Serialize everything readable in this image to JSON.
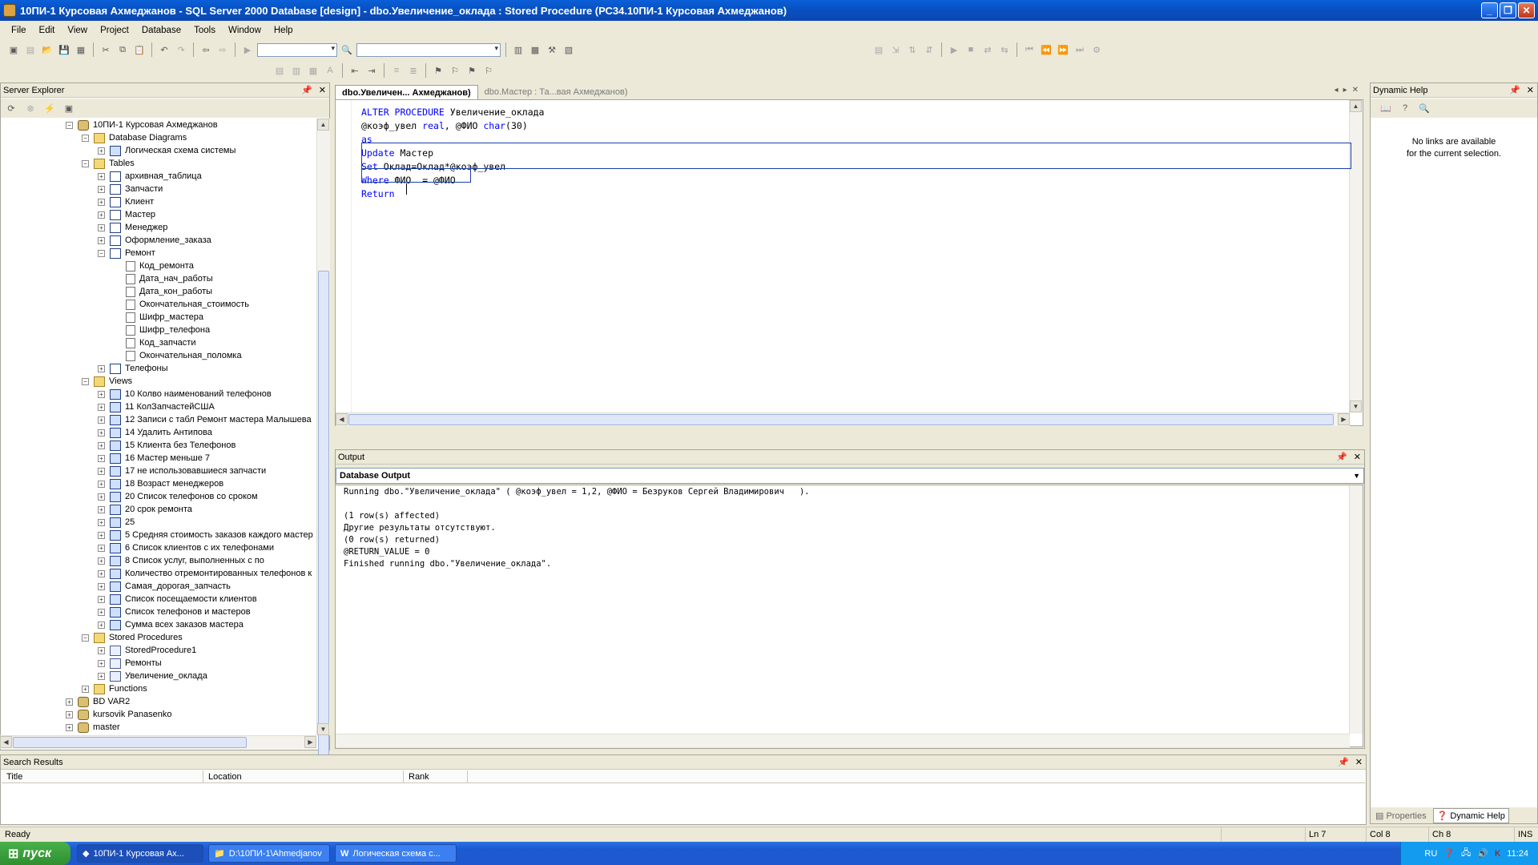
{
  "window": {
    "title": "10ПИ-1 Курсовая Ахмеджанов - SQL Server 2000 Database [design] - dbo.Увеличение_оклада : Stored Procedure (РС34.10ПИ-1 Курсовая Ахмеджанов)"
  },
  "menu": [
    "File",
    "Edit",
    "View",
    "Project",
    "Database",
    "Tools",
    "Window",
    "Help"
  ],
  "server_explorer": {
    "title": "Server Explorer",
    "items": [
      {
        "label": "10ПИ-1 Курсовая Ахмеджанов",
        "icon": "database-icon",
        "level": 0,
        "expanded": true
      },
      {
        "label": "Database Diagrams",
        "icon": "folder-icon",
        "level": 1,
        "expanded": true
      },
      {
        "label": "Логическая схема системы",
        "icon": "diagram-icon",
        "level": 2,
        "expanded": false
      },
      {
        "label": "Tables",
        "icon": "folder-icon",
        "level": 1,
        "expanded": true
      },
      {
        "label": "архивная_таблица",
        "icon": "table-icon",
        "level": 2,
        "expanded": false
      },
      {
        "label": "Запчасти",
        "icon": "table-icon",
        "level": 2,
        "expanded": false
      },
      {
        "label": "Клиент",
        "icon": "table-icon",
        "level": 2,
        "expanded": false
      },
      {
        "label": "Мастер",
        "icon": "table-icon",
        "level": 2,
        "expanded": false
      },
      {
        "label": "Менеджер",
        "icon": "table-icon",
        "level": 2,
        "expanded": false
      },
      {
        "label": "Оформление_заказа",
        "icon": "table-icon",
        "level": 2,
        "expanded": false
      },
      {
        "label": "Ремонт",
        "icon": "table-icon",
        "level": 2,
        "expanded": true
      },
      {
        "label": "Код_ремонта",
        "icon": "column-icon",
        "level": 3
      },
      {
        "label": "Дата_нач_работы",
        "icon": "column-icon",
        "level": 3
      },
      {
        "label": "Дата_кон_работы",
        "icon": "column-icon",
        "level": 3
      },
      {
        "label": "Окончательная_стоимость",
        "icon": "column-icon",
        "level": 3
      },
      {
        "label": "Шифр_мастера",
        "icon": "column-icon",
        "level": 3
      },
      {
        "label": "Шифр_телефона",
        "icon": "column-icon",
        "level": 3
      },
      {
        "label": "Код_запчасти",
        "icon": "column-icon",
        "level": 3
      },
      {
        "label": "Окончательная_поломка",
        "icon": "column-icon",
        "level": 3
      },
      {
        "label": "Телефоны",
        "icon": "table-icon",
        "level": 2,
        "expanded": false
      },
      {
        "label": "Views",
        "icon": "folder-icon",
        "level": 1,
        "expanded": true
      },
      {
        "label": "10 Колво наименований телефонов",
        "icon": "view-icon",
        "level": 2,
        "expanded": false
      },
      {
        "label": "11 КолЗапчастейСША",
        "icon": "view-icon",
        "level": 2,
        "expanded": false
      },
      {
        "label": "12 Записи с табл Ремонт мастера Малышева",
        "icon": "view-icon",
        "level": 2,
        "expanded": false
      },
      {
        "label": "14 Удалить Антипова",
        "icon": "view-icon",
        "level": 2,
        "expanded": false
      },
      {
        "label": "15 Клиента без Телефонов",
        "icon": "view-icon",
        "level": 2,
        "expanded": false
      },
      {
        "label": "16 Мастер меньше 7",
        "icon": "view-icon",
        "level": 2,
        "expanded": false
      },
      {
        "label": "17 не использовавшиеся запчасти",
        "icon": "view-icon",
        "level": 2,
        "expanded": false
      },
      {
        "label": "18 Возраст менеджеров",
        "icon": "view-icon",
        "level": 2,
        "expanded": false
      },
      {
        "label": "20 Список телефонов со сроком",
        "icon": "view-icon",
        "level": 2,
        "expanded": false
      },
      {
        "label": "20 срок ремонта",
        "icon": "view-icon",
        "level": 2,
        "expanded": false
      },
      {
        "label": "25",
        "icon": "view-icon",
        "level": 2,
        "expanded": false
      },
      {
        "label": "5 Средняя стоимость заказов каждого мастер",
        "icon": "view-icon",
        "level": 2,
        "expanded": false
      },
      {
        "label": "6 Список клиентов с их телефонами",
        "icon": "view-icon",
        "level": 2,
        "expanded": false
      },
      {
        "label": "8 Список услуг, выполненных с по",
        "icon": "view-icon",
        "level": 2,
        "expanded": false
      },
      {
        "label": "Количество отремонтированных телефонов к",
        "icon": "view-icon",
        "level": 2,
        "expanded": false
      },
      {
        "label": "Самая_дорогая_запчасть",
        "icon": "view-icon",
        "level": 2,
        "expanded": false
      },
      {
        "label": "Список посещаемости клиентов",
        "icon": "view-icon",
        "level": 2,
        "expanded": false
      },
      {
        "label": "Список телефонов и мастеров",
        "icon": "view-icon",
        "level": 2,
        "expanded": false
      },
      {
        "label": "Сумма всех заказов мастера",
        "icon": "view-icon",
        "level": 2,
        "expanded": false
      },
      {
        "label": "Stored Procedures",
        "icon": "folder-icon",
        "level": 1,
        "expanded": true
      },
      {
        "label": "StoredProcedure1",
        "icon": "stored-procedure-icon",
        "level": 2,
        "expanded": false
      },
      {
        "label": "Ремонты",
        "icon": "stored-procedure-icon",
        "level": 2,
        "expanded": false
      },
      {
        "label": "Увеличение_оклада",
        "icon": "stored-procedure-icon",
        "level": 2,
        "expanded": false
      },
      {
        "label": "Functions",
        "icon": "folder-icon",
        "level": 1,
        "expanded": false
      },
      {
        "label": "BD VAR2",
        "icon": "database-icon",
        "level": 0,
        "expanded": false
      },
      {
        "label": "kursovik Panasenko",
        "icon": "database-icon",
        "level": 0,
        "expanded": false
      },
      {
        "label": "master",
        "icon": "database-icon",
        "level": 0,
        "expanded": false
      }
    ]
  },
  "editor": {
    "tabs": [
      {
        "label": "dbo.Увеличен... Ахмеджанов)",
        "active": true
      },
      {
        "label": "dbo.Мастер : Та...вая Ахмеджанов)",
        "active": false
      }
    ],
    "lines": [
      [
        {
          "t": "ALTER PROCEDURE",
          "kw": true
        },
        {
          "t": " Увеличение_оклада",
          "kw": false
        }
      ],
      [
        {
          "t": "@коэф_увел ",
          "kw": false
        },
        {
          "t": "real",
          "kw": true
        },
        {
          "t": ", @ФИО ",
          "kw": false
        },
        {
          "t": "char",
          "kw": true
        },
        {
          "t": "(30)",
          "kw": false
        }
      ],
      [
        {
          "t": "as",
          "kw": true
        }
      ],
      [
        {
          "t": "Update",
          "kw": true
        },
        {
          "t": " Мастер",
          "kw": false
        }
      ],
      [
        {
          "t": "Set",
          "kw": true
        },
        {
          "t": " Оклад=Оклад*@коэф_увел",
          "kw": false
        }
      ],
      [
        {
          "t": "Where",
          "kw": true
        },
        {
          "t": " ФИО  = @ФИО",
          "kw": false
        }
      ],
      [
        {
          "t": "Return",
          "kw": true
        },
        {
          "t": " ",
          "kw": false
        }
      ]
    ]
  },
  "output": {
    "title": "Output",
    "pane": "Database Output",
    "lines": [
      "Running dbo.\"Увеличение_оклада\" ( @коэф_увел = 1,2, @ФИО = Безруков Сергей Владимирович   ).",
      "",
      "(1 row(s) affected)",
      "Другие результаты отсутствуют.",
      "(0 row(s) returned)",
      "@RETURN_VALUE = 0",
      "Finished running dbo.\"Увеличение_оклада\"."
    ]
  },
  "dynamic_help": {
    "title": "Dynamic Help",
    "message_line1": "No links are available",
    "message_line2": "for the current selection.",
    "tab_properties": "Properties",
    "tab_dynamic_help": "Dynamic Help"
  },
  "search_results": {
    "title": "Search Results",
    "columns": [
      "Title",
      "Location",
      "Rank"
    ]
  },
  "status": {
    "ready": "Ready",
    "ln": "Ln 7",
    "col": "Col 8",
    "ch": "Ch 8",
    "ins": "INS"
  },
  "taskbar": {
    "start": "пуск",
    "tasks": [
      {
        "label": "10ПИ-1 Курсовая Ах...",
        "active": true
      },
      {
        "label": "D:\\10ПИ-1\\Ahmedjanov",
        "active": false
      },
      {
        "label": "Логическая схема с...",
        "active": false
      }
    ],
    "lang": "RU",
    "time": "11:24"
  },
  "colors": {
    "title_bar": "#0a5fd8",
    "keyword": "#0000ff",
    "start_button": "#3c9d3c",
    "taskbar": "#245edb"
  }
}
